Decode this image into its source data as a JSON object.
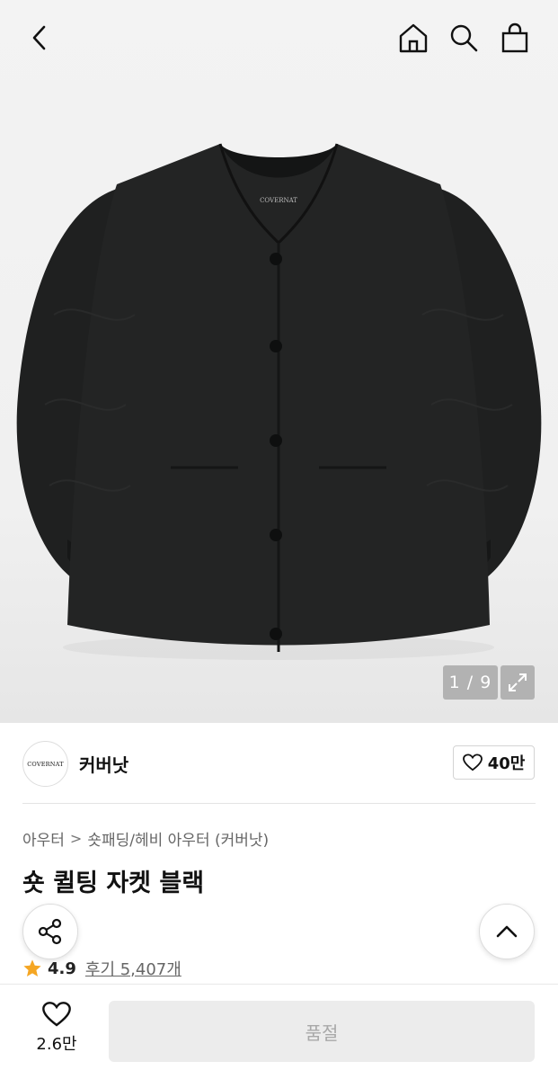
{
  "hero": {
    "image_counter": "1 / 9",
    "icons": [
      "back-arrow-icon",
      "home-icon",
      "search-icon",
      "shopping-bag-icon",
      "expand-icon"
    ],
    "jacket_label": "COVERNAT"
  },
  "brand": {
    "logo_text": "COVERNAT",
    "name": "커버낫",
    "like_count": "40만"
  },
  "breadcrumb": {
    "category": "아우터",
    "separator": ">",
    "subcategory": "숏패딩/헤비 아우터 (커버낫)"
  },
  "product": {
    "title": "숏 퀼팅 자켓 블랙"
  },
  "rating": {
    "score": "4.9",
    "reviews_label": "후기 5,407개",
    "star_color": "#f5a623"
  },
  "bottom_bar": {
    "wish_count": "2.6만",
    "buy_label": "품절"
  }
}
